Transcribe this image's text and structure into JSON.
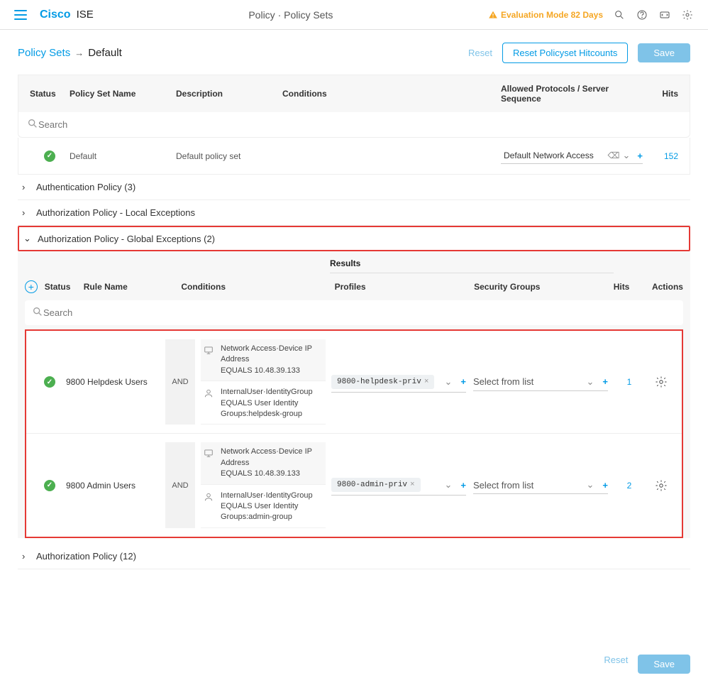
{
  "top": {
    "brand": "Cisco",
    "brand_sub": "ISE",
    "title": "Policy · Policy Sets",
    "eval_mode": "Evaluation Mode 82 Days"
  },
  "breadcrumb": {
    "root": "Policy Sets",
    "arrow": "→",
    "current": "Default",
    "reset": "Reset",
    "reset_hitcounts": "Reset Policyset Hitcounts",
    "save": "Save"
  },
  "ps_header": {
    "status": "Status",
    "name": "Policy Set Name",
    "desc": "Description",
    "cond": "Conditions",
    "proto": "Allowed Protocols / Server Sequence",
    "hits": "Hits"
  },
  "search_placeholder": "Search",
  "ps_row": {
    "name": "Default",
    "desc": "Default policy set",
    "proto": "Default Network Access",
    "hits": "152"
  },
  "accordion": {
    "auth_policy": "Authentication Policy (3)",
    "authz_local": "Authorization Policy - Local Exceptions",
    "authz_global": "Authorization Policy - Global Exceptions (2)",
    "authz_policy": "Authorization Policy (12)"
  },
  "rules_head": {
    "results_label": "Results",
    "status": "Status",
    "rule": "Rule Name",
    "cond": "Conditions",
    "profiles": "Profiles",
    "sec": "Security Groups",
    "hits": "Hits",
    "actions": "Actions",
    "search_placeholder": "Search"
  },
  "rules": [
    {
      "name": "9800 Helpdesk Users",
      "and": "AND",
      "cond1_l1": "Network Access·Device IP Address",
      "cond1_l2": "EQUALS  10.48.39.133",
      "cond2_l1": "InternalUser·IdentityGroup",
      "cond2_l2": "EQUALS  User Identity Groups:helpdesk-group",
      "profile_chip": "9800-helpdesk-priv",
      "sec_placeholder": "Select from list",
      "hits": "1"
    },
    {
      "name": "9800 Admin Users",
      "and": "AND",
      "cond1_l1": "Network Access·Device IP Address",
      "cond1_l2": "EQUALS  10.48.39.133",
      "cond2_l1": "InternalUser·IdentityGroup",
      "cond2_l2": "EQUALS  User Identity Groups:admin-group",
      "profile_chip": "9800-admin-priv",
      "sec_placeholder": "Select from list",
      "hits": "2"
    }
  ],
  "footer": {
    "reset": "Reset",
    "save": "Save"
  }
}
